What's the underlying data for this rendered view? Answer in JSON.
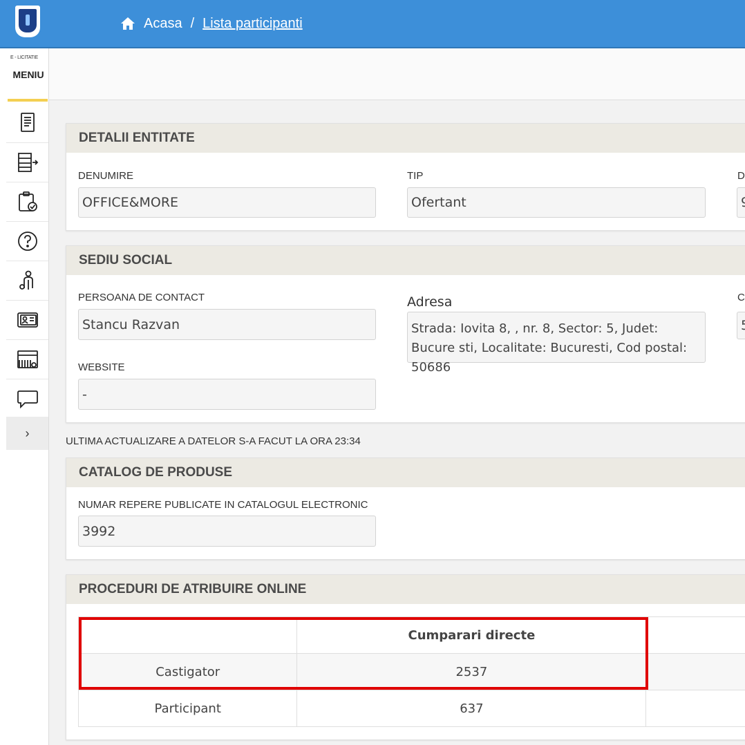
{
  "header": {
    "breadcrumb_home": "Acasa",
    "breadcrumb_separator": "/",
    "breadcrumb_current": "Lista participanti"
  },
  "sidebar": {
    "brand": "E - LICITATIE",
    "menu_label": "MENIU",
    "items": [
      {
        "icon": "document-icon"
      },
      {
        "icon": "list-export-icon"
      },
      {
        "icon": "clipboard-check-icon"
      },
      {
        "icon": "help-icon"
      },
      {
        "icon": "person-icon"
      },
      {
        "icon": "id-card-icon"
      },
      {
        "icon": "catalog-icon"
      },
      {
        "icon": "chat-icon"
      }
    ],
    "expand_glyph": "›"
  },
  "entity": {
    "title": "DETALII ENTITATE",
    "name_label": "DENUMIRE",
    "name_value": "OFFICE&MORE",
    "type_label": "TIP",
    "type_value": "Ofertant",
    "third_label_partial": "D",
    "third_value_partial": "9"
  },
  "office": {
    "title": "SEDIU SOCIAL",
    "contact_label": "PERSOANA DE CONTACT",
    "contact_value": "Stancu Razvan",
    "address_label": "Adresa",
    "address_value": "Strada: Iovita 8, , nr. 8, Sector: 5, Judet: Bucure sti, Localitate: Bucuresti, Cod postal: 50686",
    "third_label_partial": "C",
    "third_value_partial": "5",
    "website_label": "WEBSITE",
    "website_value": "-"
  },
  "updated_note": "ULTIMA ACTUALIZARE A DATELOR S-A FACUT LA ORA 23:34",
  "catalog": {
    "title": "CATALOG DE PRODUSE",
    "count_label": "NUMAR REPERE PUBLICATE IN CATALOGUL ELECTRONIC",
    "count_value": "3992"
  },
  "procedures": {
    "title": "PROCEDURI DE ATRIBUIRE ONLINE",
    "column_header": "Cumparari directe",
    "rows": [
      {
        "label": "Castigator",
        "value": "2537"
      },
      {
        "label": "Participant",
        "value": "637"
      }
    ]
  },
  "colors": {
    "topbar": "#3d8fd9",
    "panel_header": "#eceae3",
    "highlight": "#e00000",
    "accent": "#f4cf52"
  }
}
